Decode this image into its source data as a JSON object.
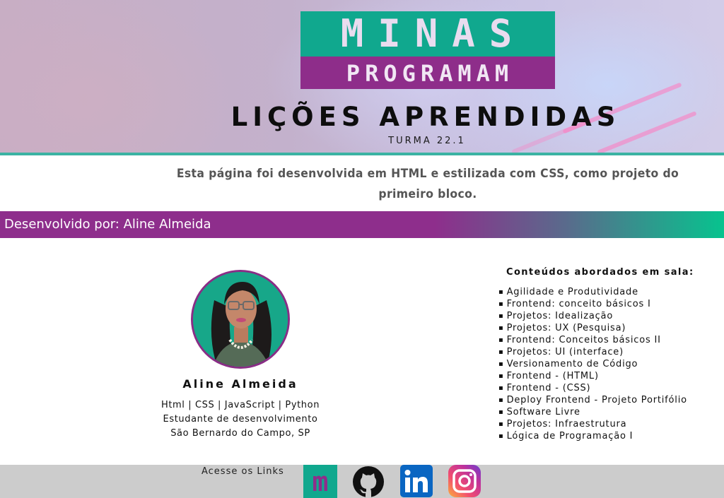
{
  "header": {
    "logo_top": "MINAS",
    "logo_bottom": "PROGRAMAM",
    "title": "LIÇÕES APRENDIDAS",
    "subtitle": "TURMA 22.1"
  },
  "intro": {
    "text": "Esta página foi desenvolvida em HTML e estilizada com CSS, como projeto do primeiro bloco."
  },
  "dev_bar": {
    "text": "Desenvolvido por: Aline Almeida"
  },
  "profile": {
    "name": "Aline Almeida",
    "skills": "Html | CSS | JavaScript | Python",
    "role": "Estudante de desenvolvimento",
    "location": "São Bernardo do Campo, SP"
  },
  "contents": {
    "title": "Conteúdos abordados em sala:",
    "items": [
      "Agilidade e Produtividade",
      "Frontend: conceito básicos I",
      "Projetos: Idealização",
      "Projetos: UX (Pesquisa)",
      "Frontend: Conceitos básicos II",
      "Projetos: UI (interface)",
      "Versionamento de Código",
      "Frontend - (HTML)",
      "Frontend - (CSS)",
      "Deploy Frontend - Projeto Portifólio",
      "Software Livre",
      "Projetos: Infraestrutura",
      "Lógica de Programação I"
    ]
  },
  "footer": {
    "label": "Acesse os Links",
    "links": [
      {
        "icon": "minas-programam-icon",
        "glyph": "m"
      },
      {
        "icon": "github-icon"
      },
      {
        "icon": "linkedin-icon"
      },
      {
        "icon": "instagram-icon"
      }
    ]
  },
  "colors": {
    "brand_green": "#10a88e",
    "brand_purple": "#8e2d8a",
    "footer_gray": "#cccccc"
  }
}
